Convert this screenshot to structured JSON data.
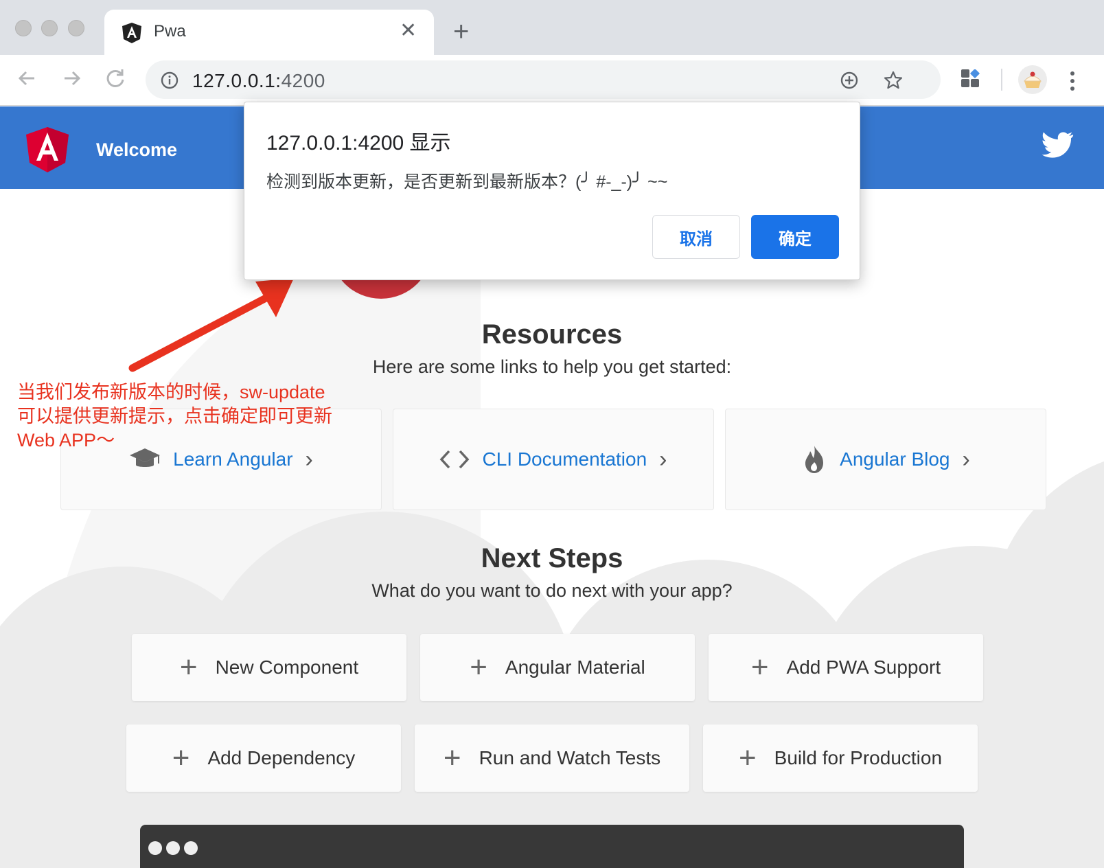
{
  "browser": {
    "tab_title": "Pwa",
    "url_host": "127.0.0.1:",
    "url_port": "4200"
  },
  "app_header": {
    "title": "Welcome"
  },
  "resources": {
    "title": "Resources",
    "subtitle": "Here are some links to help you get started:",
    "links": [
      {
        "label": "Learn Angular",
        "icon": "graduation-cap-icon"
      },
      {
        "label": "CLI Documentation",
        "icon": "code-icon"
      },
      {
        "label": "Angular Blog",
        "icon": "flame-icon"
      }
    ]
  },
  "next_steps": {
    "title": "Next Steps",
    "subtitle": "What do you want to do next with your app?",
    "items": [
      {
        "label": "New Component"
      },
      {
        "label": "Angular Material"
      },
      {
        "label": "Add PWA Support"
      },
      {
        "label": "Add Dependency"
      },
      {
        "label": "Run and Watch Tests"
      },
      {
        "label": "Build for Production"
      }
    ]
  },
  "annotation": {
    "lines": [
      "当我们发布新版本的时候，sw-update",
      "可以提供更新提示，点击确定即可更新",
      "Web APP～"
    ],
    "color": "#e8321f"
  },
  "dialog": {
    "title": "127.0.0.1:4200 显示",
    "message": "检测到版本更新，是否更新到最新版本？(╯ #-_-)╯ ~~",
    "cancel_label": "取消",
    "ok_label": "确定"
  },
  "colors": {
    "header_blue": "#3677cf",
    "link_blue": "#1976d2",
    "angular_red": "#dd0031",
    "button_blue": "#1a73e8"
  }
}
